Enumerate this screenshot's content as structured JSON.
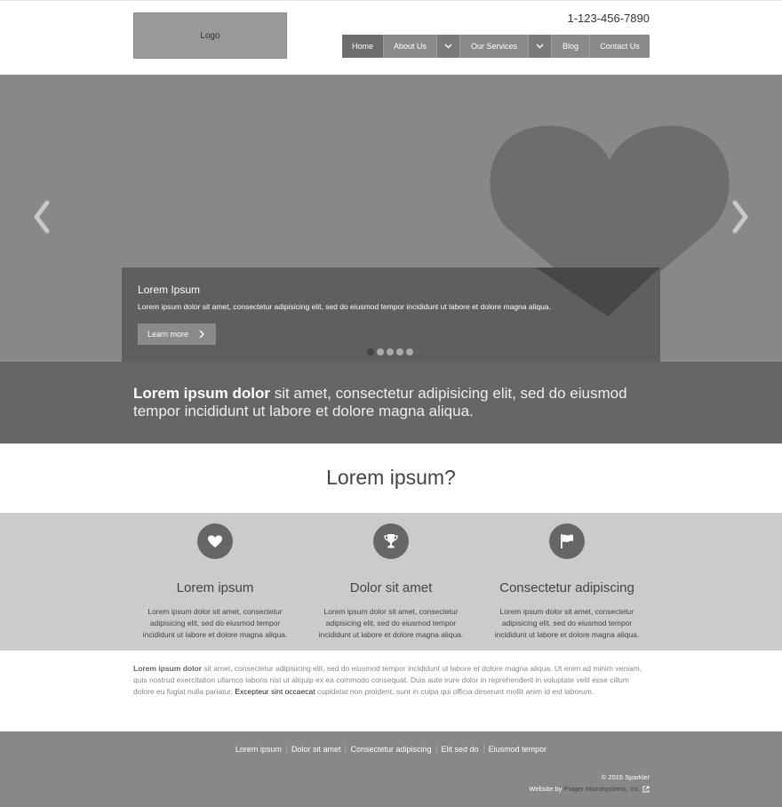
{
  "header": {
    "logo": "Logo",
    "phone": "1-123-456-7890",
    "nav": {
      "home": "Home",
      "about": "About Us",
      "services": "Our Services",
      "blog": "Blog",
      "contact": "Contact Us"
    }
  },
  "hero": {
    "caption_title": "Lorem Ipsum",
    "caption_text": "Lorem ipsum dolor sit amet, consectetur adipisicing elit, sed do eiusmod tempor incididunt ut labore et dolore magna aliqua.",
    "button": "Learn more",
    "slide_count": 5,
    "active_slide": 1
  },
  "band": {
    "bold": "Lorem ipsum dolor",
    "rest": " sit amet, consectetur adipisicing elit, sed do eiusmod tempor incididunt ut labore et dolore magna aliqua."
  },
  "section_title": "Lorem ipsum?",
  "features": [
    {
      "icon": "heart-icon",
      "title": "Lorem ipsum",
      "text": "Lorem ipsum dolor sit amet, consectetur adipisicing elit, sed do eiusmod tempor incididunt ut labore et dolore magna aliqua."
    },
    {
      "icon": "trophy-icon",
      "title": "Dolor sit amet",
      "text": "Lorem ipsum dolor sit amet, consectetur adipisicing elit, sed do eiusmod tempor incididunt ut labore et dolore magna aliqua."
    },
    {
      "icon": "flag-icon",
      "title": "Consectetur adipiscing",
      "text": "Lorem ipsum dolor sit amet, consectetur adipisicing elit, sed do eiusmod tempor incididunt ut labore et dolore magna aliqua."
    }
  ],
  "paragraph": {
    "bold": "Lorem ipsum dolor",
    "part1": " sit amet, consectetur adipisicing elit, sed do eiusmod tempor incididunt ut labore et dolore magna aliqua. Ut enim ad minim veniam, quis nostrud exercitation ullamco laboris nisi ut aliquip ex ea commodo consequat. Duis aute irure dolor in reprehenderit in voluptate velit esse cillum dolore eu fugiat nulla pariatur. ",
    "dark": "Excepteur sint occaecat",
    "part2": " cupidatat non proident, sunt in culpa qui officia deserunt mollit anim id est laborum."
  },
  "footer": {
    "links": [
      "Lorem ipsum",
      "Dolor sit amet",
      "Consectetur adipiscing",
      "Elit sed do",
      "Eiusmod tempor"
    ],
    "copyright": "© 2015 Sparkler",
    "credit_prefix": "Website by",
    "credit_company": "Prager Microsystems, Inc."
  },
  "colors": {
    "hero_bg": "#888888",
    "caption_bg": "#5f5f5f",
    "band_bg": "#666666",
    "features_bg": "#cbcbcb",
    "footer_bg": "#888888"
  }
}
